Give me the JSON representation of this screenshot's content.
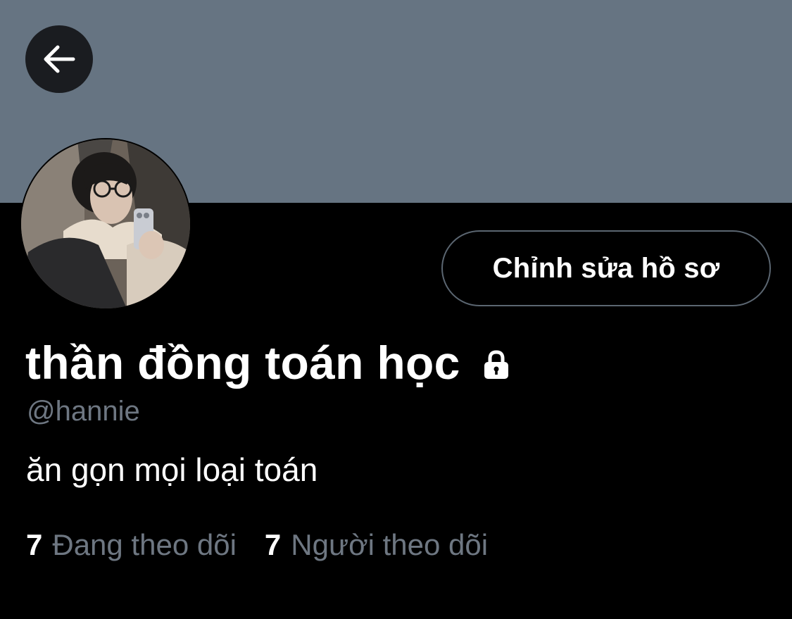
{
  "profile": {
    "banner_color": "#667482",
    "back_icon": "arrow-left-icon",
    "avatar_alt": "profile photo",
    "edit_button_label": "Chỉnh sửa hồ sơ",
    "display_name": "thần đồng toán học",
    "lock_icon": "lock-icon",
    "handle": "@hannie",
    "bio": "ăn gọn mọi loại toán",
    "following_count": "7",
    "following_label": "Đang theo dõi",
    "followers_count": "7",
    "followers_label": "Người theo dõi"
  },
  "colors": {
    "background": "#000000",
    "text_primary": "#ffffff",
    "text_secondary": "#6e7782",
    "button_border": "#5b6671"
  }
}
